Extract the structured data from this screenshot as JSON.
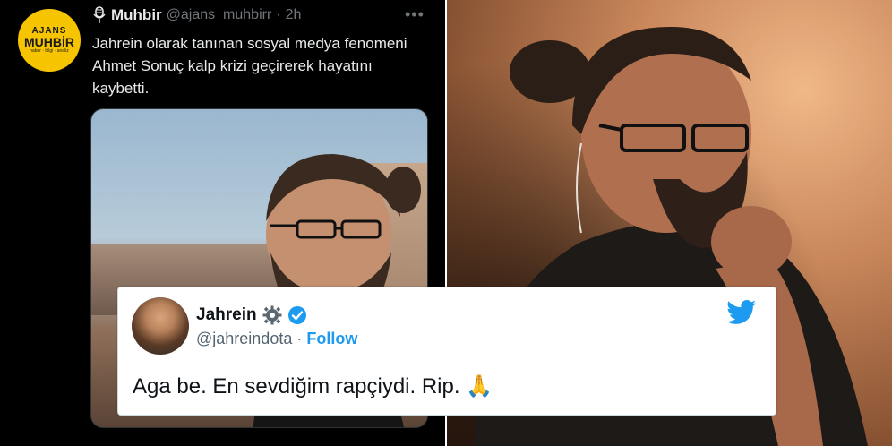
{
  "left_tweet": {
    "avatar_text": [
      "AJANS",
      "MUHBİR",
      "haber · bilgi · analiz"
    ],
    "display_name": "Muhbir",
    "handle": "@ajans_muhbirr",
    "separator": "·",
    "time": "2h",
    "more": "•••",
    "text": "Jahrein olarak tanınan sosyal medya fenomeni Ahmet Sonuç kalp krizi geçirerek hayatını kaybetti."
  },
  "embedded_tweet": {
    "display_name": "Jahrein",
    "handle": "@jahreindota",
    "separator": "·",
    "follow_label": "Follow",
    "text": "Aga be. En sevdiğim rapçiydi. Rip.",
    "emoji": "🙏",
    "accent_color": "#1d9bf0"
  }
}
